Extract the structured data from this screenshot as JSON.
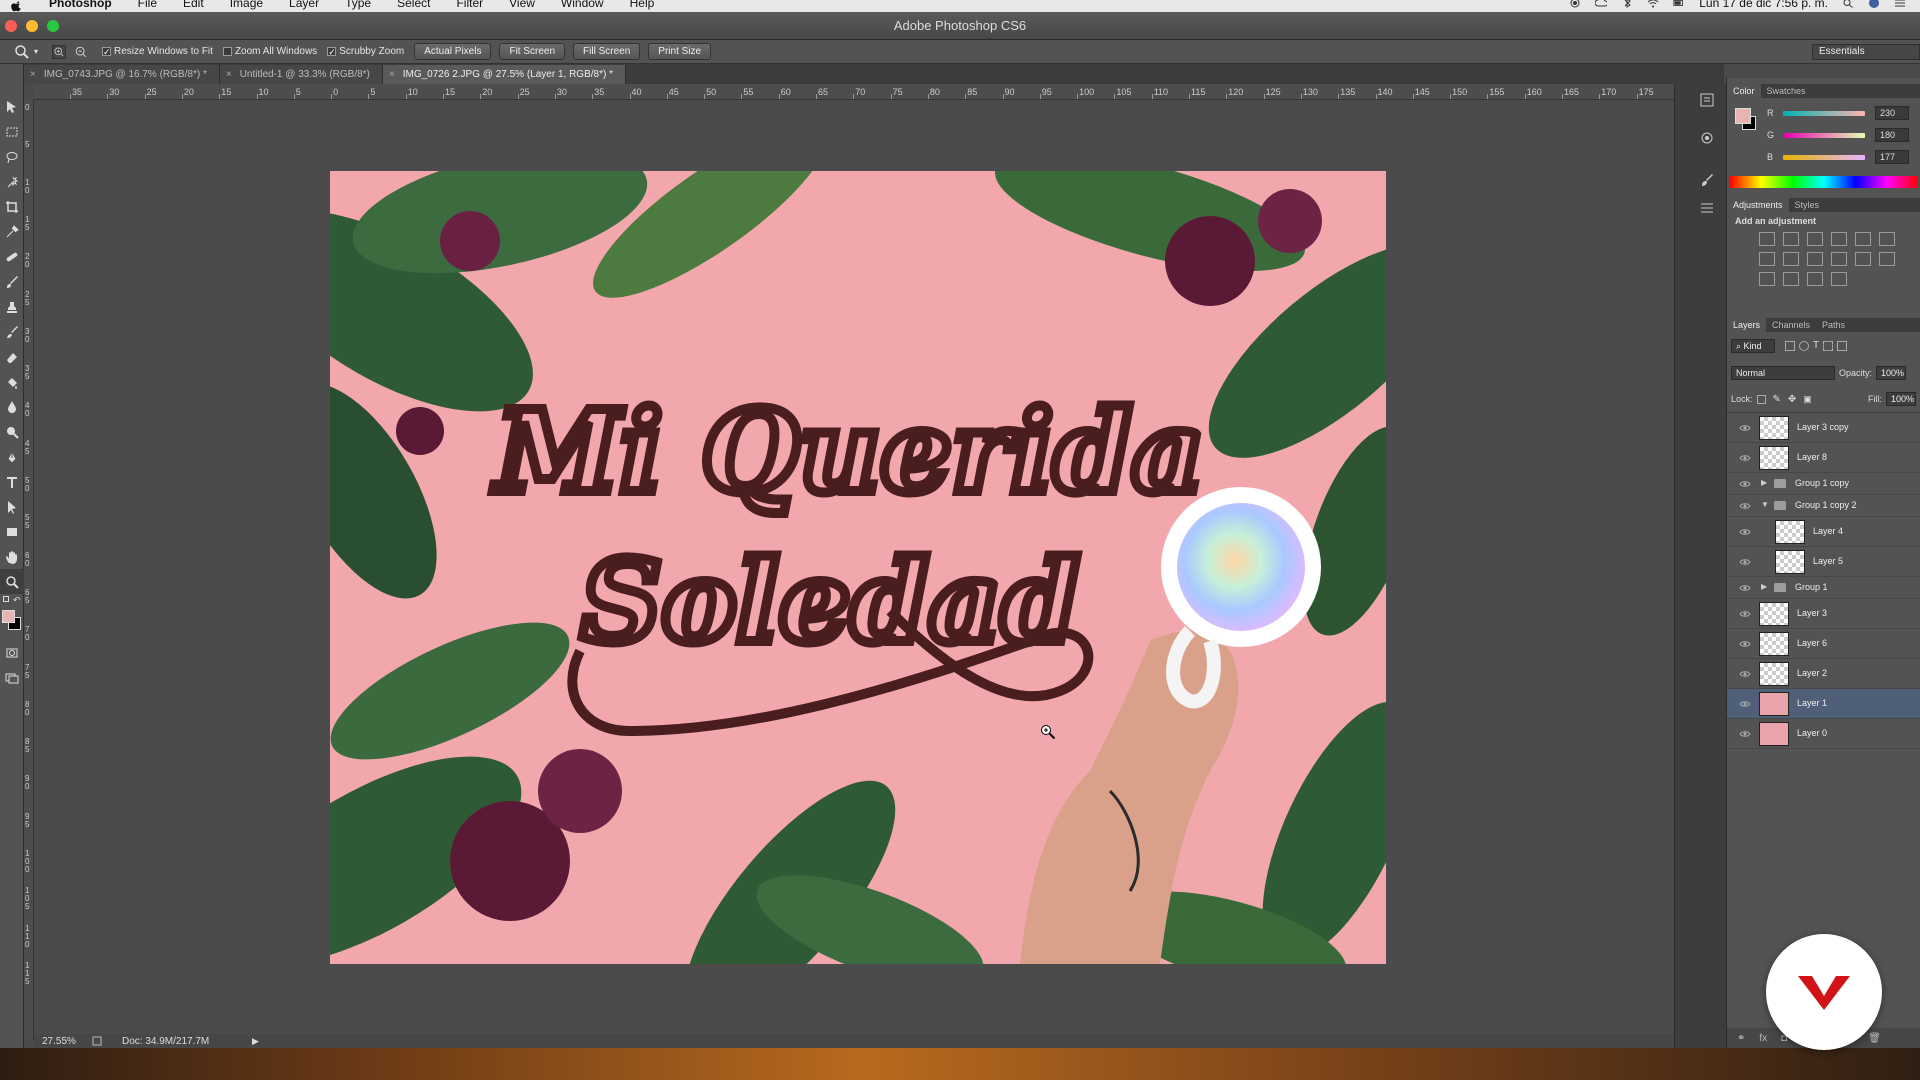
{
  "menubar": {
    "app_name": "Photoshop",
    "items": [
      "File",
      "Edit",
      "Image",
      "Layer",
      "Type",
      "Select",
      "Filter",
      "View",
      "Window",
      "Help"
    ],
    "clock": "Lun 17 de dic  7:56 p. m."
  },
  "window": {
    "title": "Adobe Photoshop CS6"
  },
  "options_bar": {
    "resize_windows": "Resize Windows to Fit",
    "zoom_all": "Zoom All Windows",
    "scrubby_zoom": "Scrubby Zoom",
    "actual_pixels": "Actual Pixels",
    "fit_screen": "Fit Screen",
    "fill_screen": "Fill Screen",
    "print_size": "Print Size",
    "workspace": "Essentials"
  },
  "tabs": [
    {
      "label": "IMG_0743.JPG @ 16.7% (RGB/8*) *",
      "active": false
    },
    {
      "label": "Untitled-1 @ 33.3% (RGB/8*)",
      "active": false
    },
    {
      "label": "IMG_0726 2.JPG @ 27.5% (Layer 1, RGB/8*) *",
      "active": true
    }
  ],
  "ruler": {
    "horizontal": [
      "35",
      "30",
      "25",
      "20",
      "15",
      "10",
      "5",
      "0",
      "5",
      "10",
      "15",
      "20",
      "25",
      "30",
      "35",
      "40",
      "45",
      "50",
      "55",
      "60",
      "65",
      "70",
      "75",
      "80",
      "85",
      "90",
      "95",
      "100",
      "105",
      "110",
      "115",
      "120",
      "125",
      "130",
      "135",
      "140",
      "145",
      "150",
      "155",
      "160",
      "165",
      "170",
      "175"
    ],
    "vertical": [
      "0",
      "5",
      "1 0",
      "1 5",
      "2 0",
      "2 5",
      "3 0",
      "3 5",
      "4 0",
      "4 5",
      "5 0",
      "5 5",
      "6 0",
      "6 5",
      "7 0",
      "7 5",
      "8 0",
      "8 5",
      "9 0",
      "9 5",
      "1 0 0",
      "1 0 5",
      "1 1 0",
      "1 1 5"
    ]
  },
  "artwork": {
    "line1": "Mi Querida",
    "line2": "Soledad"
  },
  "status": {
    "zoom": "27.55%",
    "doc": "Doc: 34.9M/217.7M"
  },
  "color_panel": {
    "tabs": [
      "Color",
      "Swatches"
    ],
    "channels": [
      {
        "label": "R",
        "value": "230",
        "fraction": 0.9
      },
      {
        "label": "G",
        "value": "180",
        "fraction": 0.706
      },
      {
        "label": "B",
        "value": "177",
        "fraction": 0.694
      }
    ],
    "foreground": "#E6B4B1"
  },
  "adjustments_panel": {
    "tabs": [
      "Adjustments",
      "Styles"
    ],
    "heading": "Add an adjustment",
    "icons": [
      "brightness-contrast-icon",
      "levels-icon",
      "curves-icon",
      "exposure-icon",
      "vibrance-icon",
      "hue-saturation-icon",
      "color-balance-icon",
      "black-white-icon",
      "photo-filter-icon",
      "channel-mixer-icon",
      "color-lookup-icon",
      "invert-icon",
      "posterize-icon",
      "threshold-icon",
      "selective-color-icon",
      "gradient-map-icon"
    ]
  },
  "layers_panel": {
    "tabs": [
      "Layers",
      "Channels",
      "Paths"
    ],
    "filter": "Kind",
    "blend_mode": "Normal",
    "opacity_label": "Opacity:",
    "opacity": "100%",
    "lock_label": "Lock:",
    "fill_label": "Fill:",
    "fill": "100%",
    "layers": [
      {
        "name": "Layer 3 copy",
        "kind": "layer",
        "indent": 0,
        "selected": false
      },
      {
        "name": "Layer 8",
        "kind": "layer",
        "indent": 0,
        "selected": false
      },
      {
        "name": "Group 1 copy",
        "kind": "group",
        "expanded": false,
        "indent": 0,
        "selected": false
      },
      {
        "name": "Group 1 copy 2",
        "kind": "group",
        "expanded": true,
        "indent": 0,
        "selected": false
      },
      {
        "name": "Layer 4",
        "kind": "layer",
        "indent": 1,
        "selected": false
      },
      {
        "name": "Layer 5",
        "kind": "layer",
        "indent": 1,
        "selected": false
      },
      {
        "name": "Group 1",
        "kind": "group",
        "expanded": false,
        "indent": 0,
        "selected": false
      },
      {
        "name": "Layer 3",
        "kind": "layer",
        "indent": 0,
        "selected": false
      },
      {
        "name": "Layer 6",
        "kind": "layer",
        "indent": 0,
        "selected": false
      },
      {
        "name": "Layer 2",
        "kind": "layer",
        "indent": 0,
        "selected": false
      },
      {
        "name": "Layer 1",
        "kind": "photo",
        "indent": 0,
        "selected": true
      },
      {
        "name": "Layer 0",
        "kind": "photo",
        "indent": 0,
        "selected": false
      }
    ]
  },
  "colors": {
    "accent_selected": "#4F5F78",
    "canvas_bg": "#F2A7AD",
    "lettering": "#4A1E1E",
    "logo_red": "#D11318"
  }
}
